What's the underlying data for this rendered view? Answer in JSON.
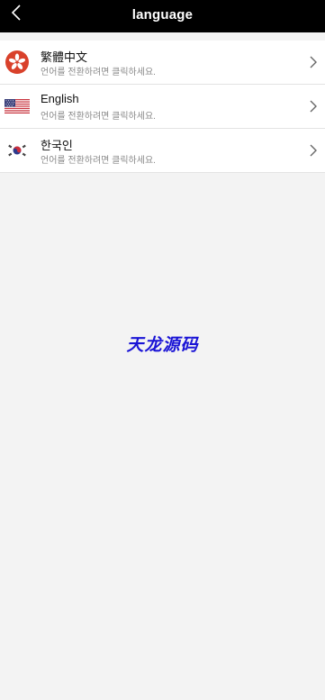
{
  "header": {
    "title": "language",
    "back_icon": "chevron-left-icon"
  },
  "languages": [
    {
      "name": "繁體中文",
      "description": "언어를 전환하려면 클릭하세요.",
      "flag_icon": "hong-kong-flag-icon"
    },
    {
      "name": "English",
      "description": "언어를 전환하려면 클릭하세요.",
      "flag_icon": "us-flag-icon"
    },
    {
      "name": "한국인",
      "description": "언어를 전환하려면 클릭하세요.",
      "flag_icon": "korea-flag-icon"
    }
  ],
  "watermark": "天龙源码",
  "colors": {
    "header_bg": "#000000",
    "page_bg": "#f3f3f3",
    "watermark": "#1a14d6",
    "hk_flag_red": "#d9412b"
  }
}
